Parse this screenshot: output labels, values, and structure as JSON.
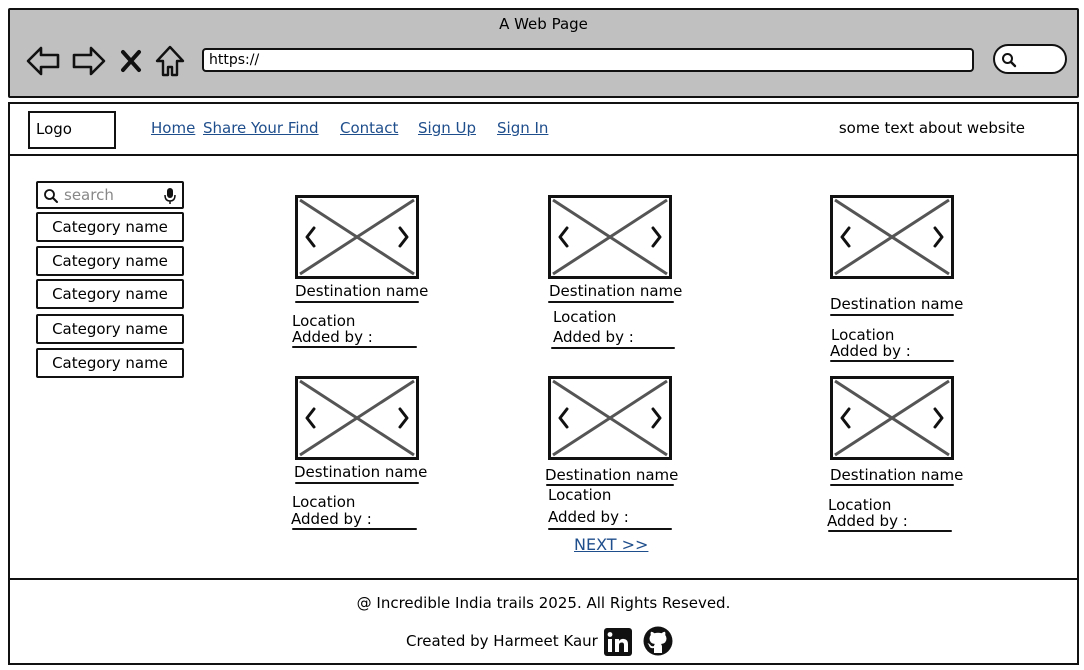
{
  "window": {
    "title": "A Web Page"
  },
  "browser": {
    "url": "https://"
  },
  "header": {
    "logo": "Logo",
    "nav": [
      "Home",
      "Share Your Find",
      "Contact",
      "Sign Up",
      "Sign In"
    ],
    "tagline": "some text about website"
  },
  "sidebar": {
    "search_placeholder": "search",
    "categories": [
      "Category name",
      "Category name",
      "Category name",
      "Category name",
      "Category name"
    ]
  },
  "cards": [
    {
      "name": "Destination name",
      "location": "Location",
      "added_by": "Added by :"
    },
    {
      "name": "Destination name",
      "location": "Location",
      "added_by": "Added by :"
    },
    {
      "name": "Destination name",
      "location": "Location",
      "added_by": "Added by :"
    },
    {
      "name": "Destination name",
      "location": "Location",
      "added_by": "Added by :"
    },
    {
      "name": "Destination name",
      "location": "Location",
      "added_by": "Added by :"
    },
    {
      "name": "Destination name",
      "location": "Location",
      "added_by": "Added by :"
    }
  ],
  "pagination": {
    "next": "NEXT >>"
  },
  "footer": {
    "copyright": "@ Incredible India trails 2025. All Rights Reseved.",
    "credit": "Created by Harmeet Kaur"
  },
  "colors": {
    "chrome": "#c0c0c0",
    "link": "#1f4e8c"
  },
  "icons": [
    "back-arrow-icon",
    "forward-arrow-icon",
    "stop-icon",
    "home-icon",
    "search-icon",
    "microphone-icon",
    "image-placeholder-icon",
    "linkedin-icon",
    "github-icon"
  ]
}
